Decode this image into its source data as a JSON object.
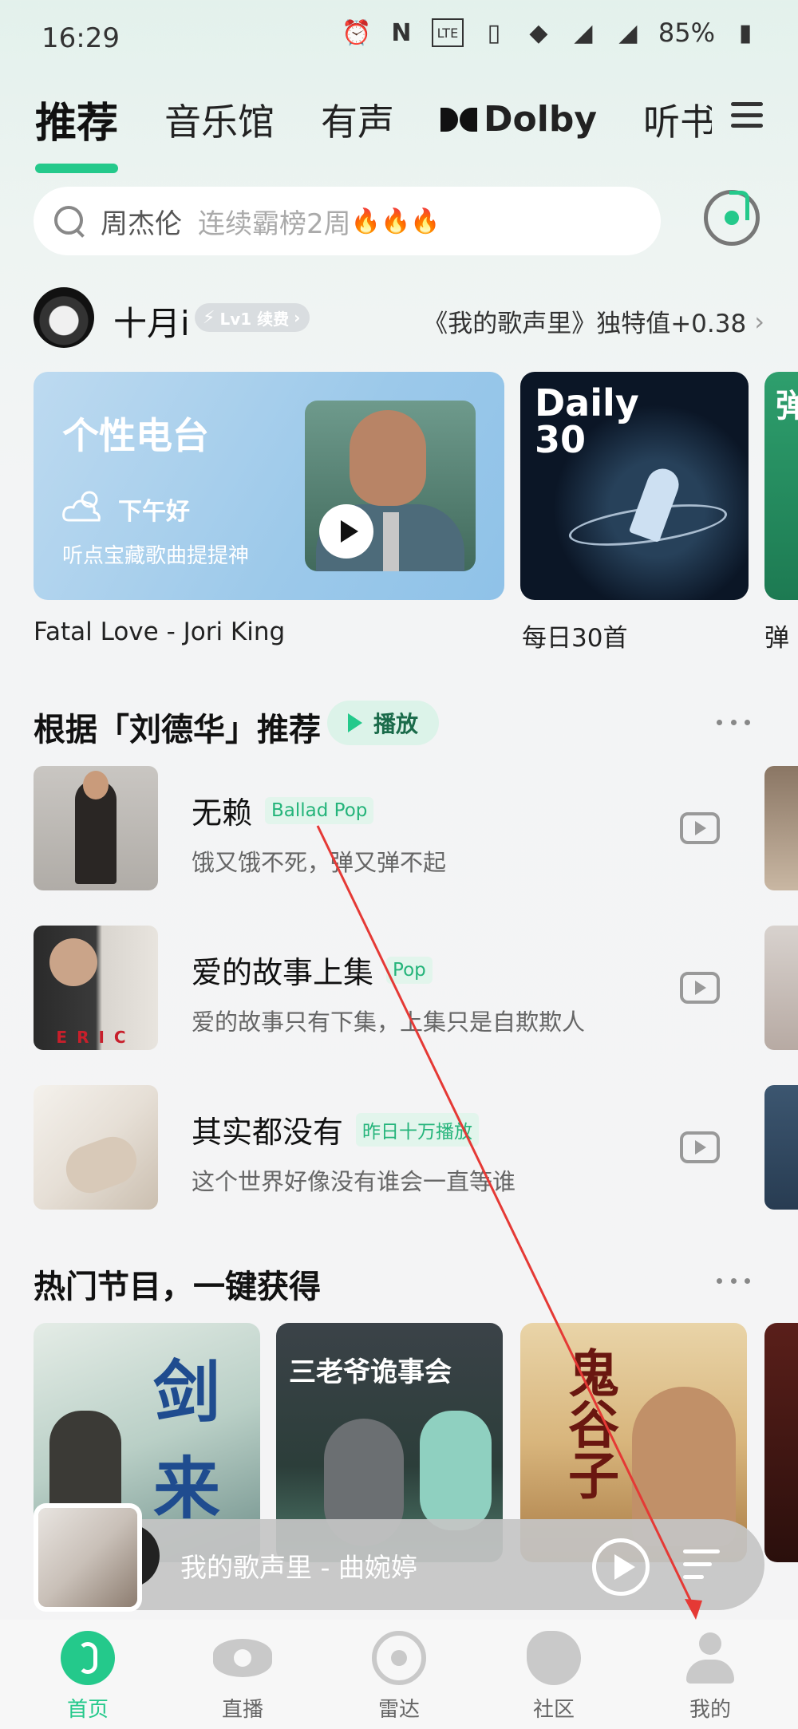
{
  "status_bar": {
    "time": "16:29",
    "battery": "85%",
    "icons": [
      "alarm-icon",
      "nfc-icon",
      "volte-icon",
      "vibrate-icon",
      "wifi-icon",
      "signal-4g-icon",
      "signal-4g-icon",
      "battery-icon"
    ]
  },
  "tabs": [
    {
      "label": "推荐",
      "active": true
    },
    {
      "label": "音乐馆"
    },
    {
      "label": "有声"
    },
    {
      "label": "Dolby"
    },
    {
      "label": "听书"
    }
  ],
  "search": {
    "hot": "周杰伦",
    "sub": "连续霸榜2周"
  },
  "user": {
    "name": "十月i",
    "level": "Lv1 续费",
    "unique_value": "《我的歌声里》独特值+0.38"
  },
  "cards": {
    "radio": {
      "title": "个性电台",
      "greeting": "下午好",
      "sub": "听点宝藏歌曲提提神",
      "caption": "Fatal Love - Jori King"
    },
    "daily": {
      "title_line1": "Daily",
      "title_line2": "30",
      "caption": "每日30首"
    },
    "third": {
      "title": "弹",
      "caption": "弹"
    }
  },
  "recommend": {
    "title": "根据「刘德华」推荐",
    "play_label": "播放",
    "songs": [
      {
        "title": "无赖",
        "tag": "Ballad Pop",
        "desc": "饿又饿不死，弹又弹不起"
      },
      {
        "title": "爱的故事上集",
        "tag": "Pop",
        "desc": "爱的故事只有下集，上集只是自欺欺人"
      },
      {
        "title": "其实都没有",
        "tag": "昨日十万播放",
        "desc": "这个世界好像没有谁会一直等谁"
      }
    ]
  },
  "programs": {
    "title": "热门节目，一键获得",
    "items": [
      {
        "title": "剑来"
      },
      {
        "title": "三老爷诡事会"
      },
      {
        "title": "鬼谷子"
      }
    ]
  },
  "mini_player": {
    "text": "我的歌声里 - 曲婉婷"
  },
  "bottom_nav": [
    {
      "label": "首页",
      "active": true
    },
    {
      "label": "直播"
    },
    {
      "label": "雷达"
    },
    {
      "label": "社区"
    },
    {
      "label": "我的"
    }
  ],
  "colors": {
    "accent": "#24c98b",
    "annotation": "#e53935"
  }
}
